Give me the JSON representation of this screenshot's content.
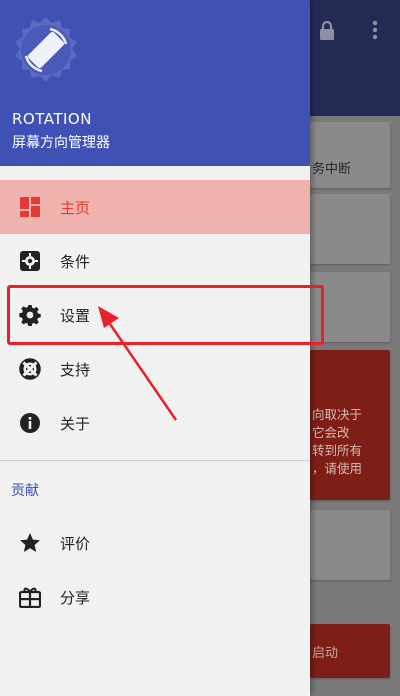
{
  "background": {
    "card1_text": "务中断",
    "card4_text": "向取决于\n它会改\n转到所有\n，请使用",
    "card6_text": "启动"
  },
  "drawer": {
    "app_name": "ROTATION",
    "app_subtitle": "屏幕方向管理器",
    "items": [
      {
        "label": "主页",
        "icon": "dashboard-icon"
      },
      {
        "label": "条件",
        "icon": "conditions-icon"
      },
      {
        "label": "设置",
        "icon": "gear-icon"
      },
      {
        "label": "支持",
        "icon": "lifebuoy-icon"
      },
      {
        "label": "关于",
        "icon": "info-icon"
      }
    ],
    "section_title": "贡献",
    "contribute_items": [
      {
        "label": "评价",
        "icon": "star-icon"
      },
      {
        "label": "分享",
        "icon": "share-gift-icon"
      }
    ]
  },
  "colors": {
    "header": "#3f51b5",
    "active_bg": "#f0b2ad",
    "active_text": "#e53935",
    "annotation": "#e8202a"
  }
}
